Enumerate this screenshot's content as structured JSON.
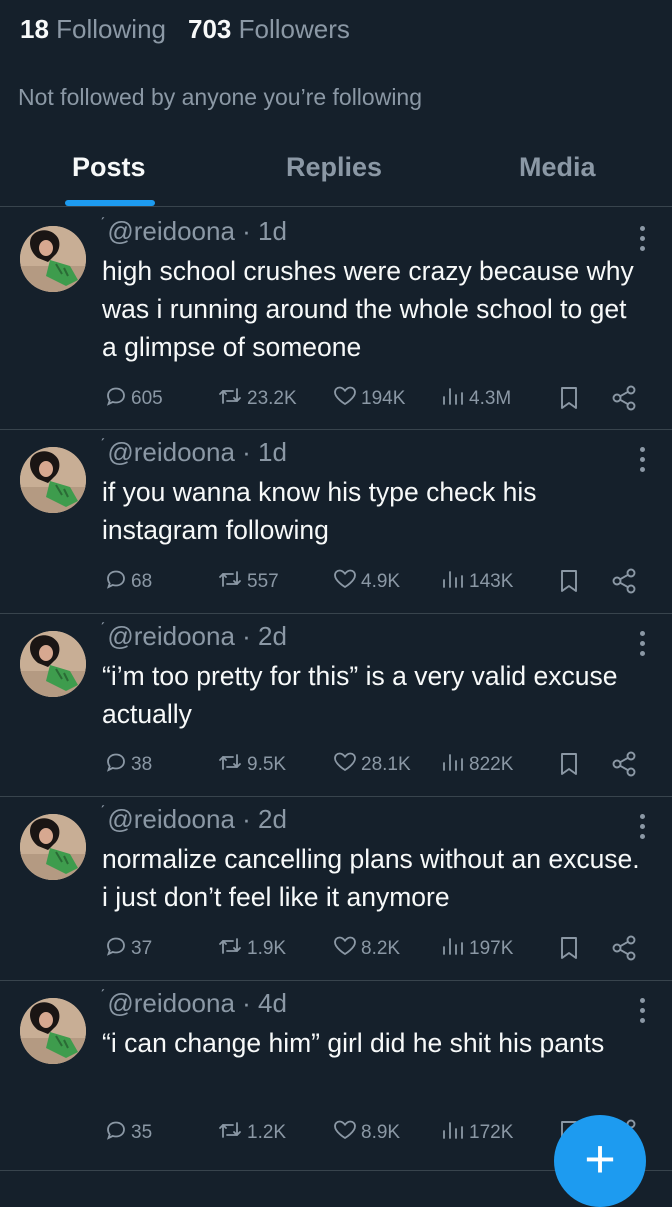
{
  "profile": {
    "following_count": "18",
    "following_label": "Following",
    "followers_count": "703",
    "followers_label": "Followers",
    "not_followed_text": "Not followed by anyone you’re following"
  },
  "tabs": [
    {
      "label": "Posts",
      "active": true
    },
    {
      "label": "Replies",
      "active": false
    },
    {
      "label": "Media",
      "active": false
    }
  ],
  "posts": [
    {
      "handle": "@reidoona",
      "time": "1d",
      "text": "high school crushes were crazy because why was i running around the whole school to get a glimpse of someone",
      "replies": "605",
      "reposts": "23.2K",
      "likes": "194K",
      "views": "4.3M"
    },
    {
      "handle": "@reidoona",
      "time": "1d",
      "text": "if you wanna know his type check his instagram following",
      "replies": "68",
      "reposts": "557",
      "likes": "4.9K",
      "views": "143K"
    },
    {
      "handle": "@reidoona",
      "time": "2d",
      "text": "“i’m too pretty for this” is a very valid excuse actually",
      "replies": "38",
      "reposts": "9.5K",
      "likes": "28.1K",
      "views": "822K"
    },
    {
      "handle": "@reidoona",
      "time": "2d",
      "text": "normalize cancelling plans without an excuse. i just don’t feel like it anymore",
      "replies": "37",
      "reposts": "1.9K",
      "likes": "8.2K",
      "views": "197K"
    },
    {
      "handle": "@reidoona",
      "time": "4d",
      "text": "“i can change him” girl did he shit his pants",
      "replies": "35",
      "reposts": "1.2K",
      "likes": "8.9K",
      "views": "172K"
    }
  ],
  "fab": {
    "label": "+"
  },
  "colors": {
    "background": "#15202b",
    "accent": "#1d9bf0",
    "muted": "#8b98a5",
    "divider": "#38444d"
  }
}
